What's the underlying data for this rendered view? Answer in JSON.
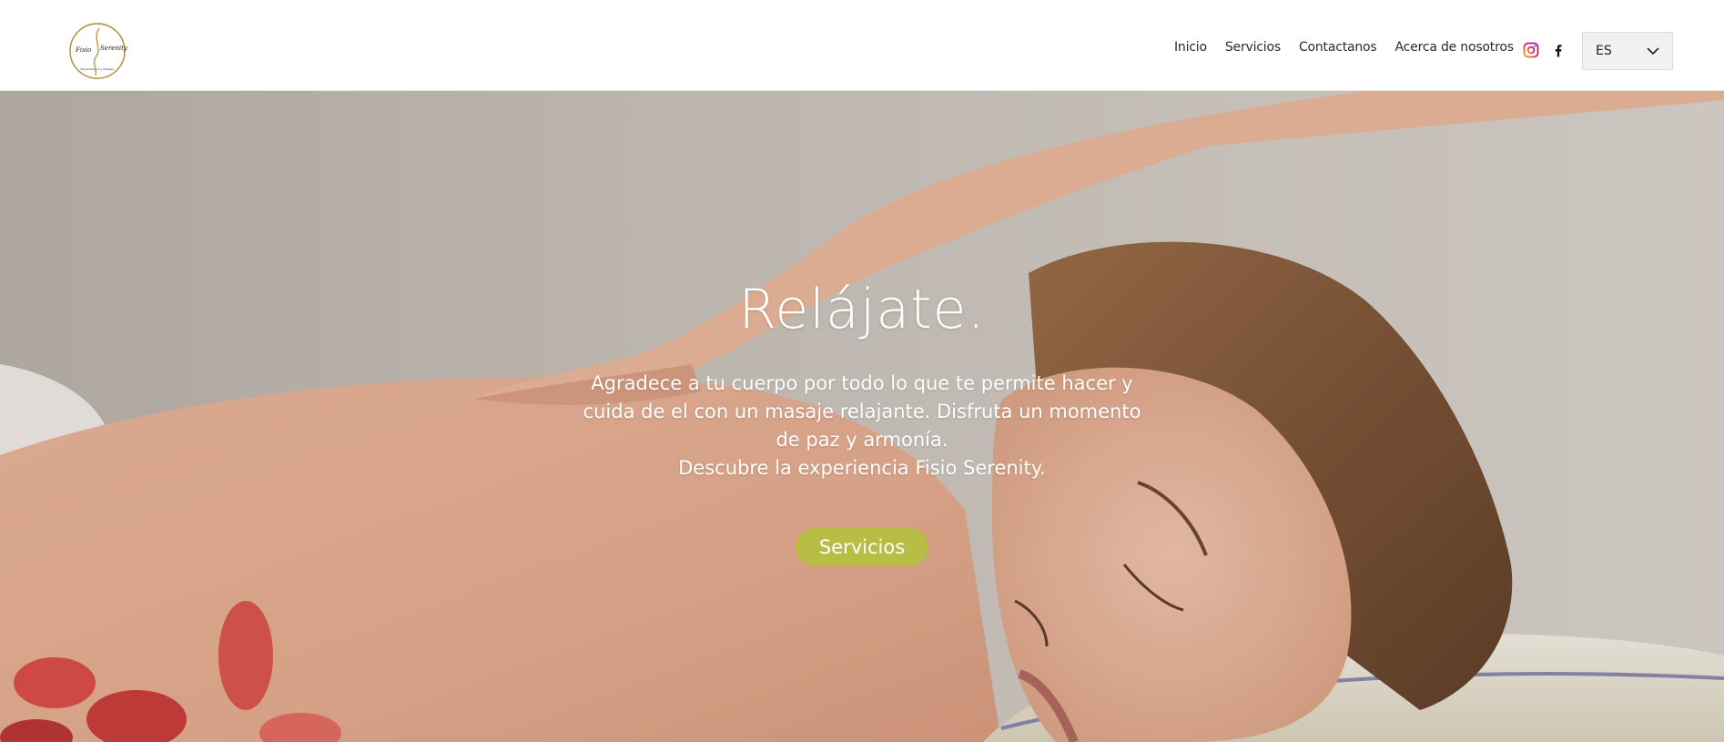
{
  "header": {
    "logo_text_left": "Fisio",
    "logo_text_right": "Serenity",
    "logo_tagline": "Rehabilitación y Masajes",
    "nav": [
      {
        "label": "Inicio"
      },
      {
        "label": "Servicios"
      },
      {
        "label": "Contactanos"
      },
      {
        "label": "Acerca de nosotros"
      }
    ],
    "social": [
      "instagram-icon",
      "facebook-icon"
    ],
    "language": "ES"
  },
  "hero": {
    "title": "Relájate.",
    "line1": "Agradece a tu cuerpo por todo lo que te permite hacer y cuida de el con un masaje relajante. Disfruta un momento de paz y armonía.",
    "line2": "Descubre la experiencia Fisio Serenity.",
    "button_label": "Servicios",
    "button_color": "#b8bd45"
  }
}
